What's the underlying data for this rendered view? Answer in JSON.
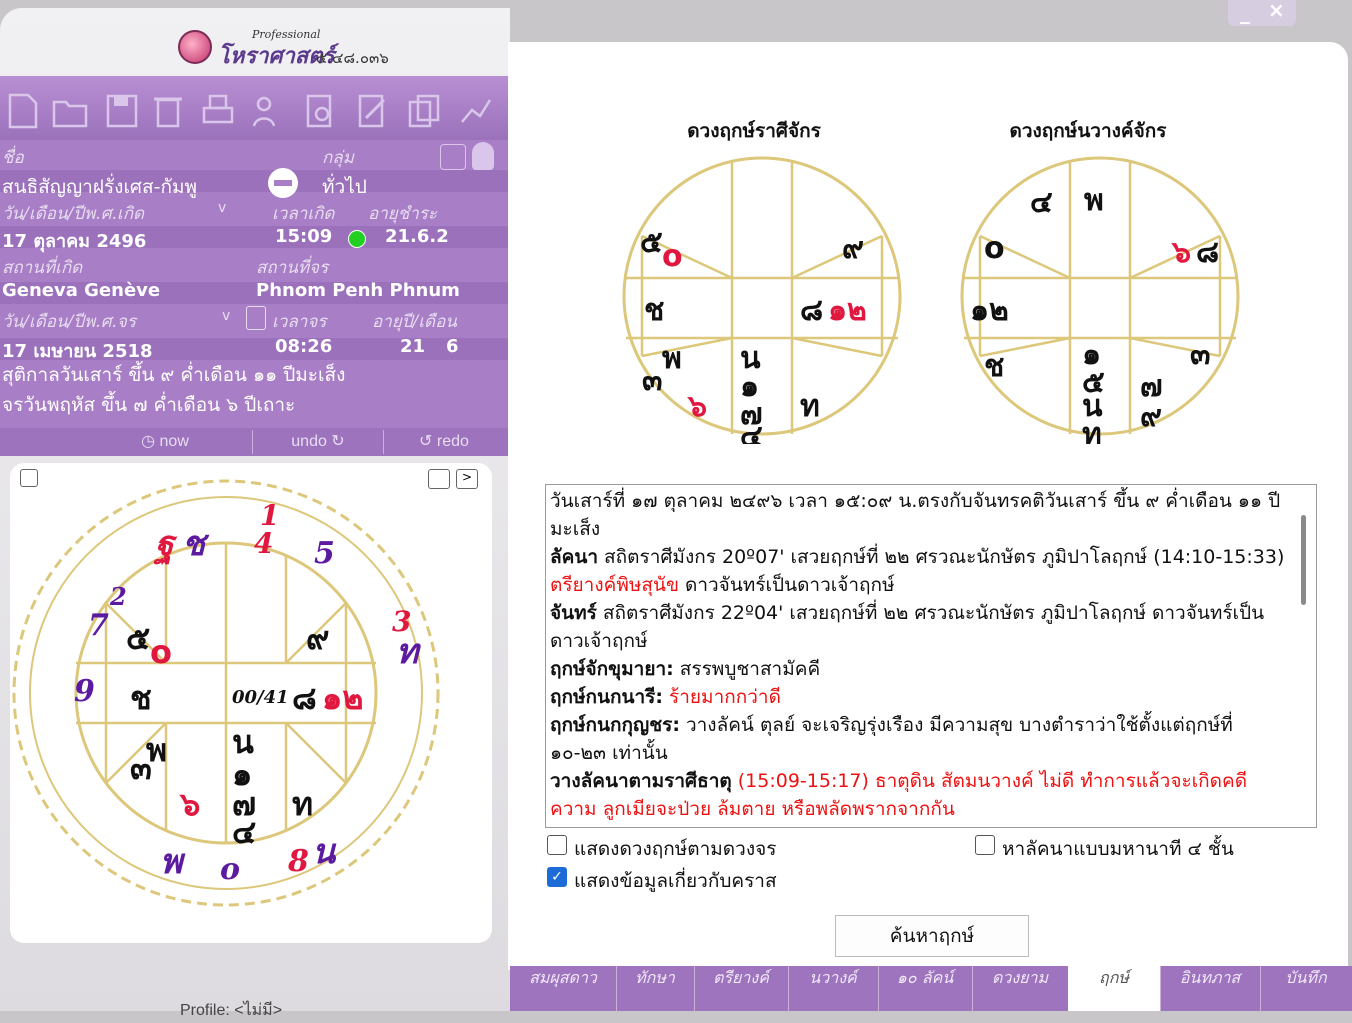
{
  "window": {
    "minimize": "_",
    "close": "×"
  },
  "app": {
    "title_small": "Professional",
    "title_main": "โหราศาสตร์",
    "version": "๕.๔๘.๐๓๖"
  },
  "toolbar": {
    "icons": [
      "new-file-icon",
      "open-folder-icon",
      "save-icon",
      "delete-icon",
      "print-icon",
      "people-icon",
      "search-doc-icon",
      "edit-icon",
      "copy-icon",
      "graph-icon"
    ]
  },
  "info": {
    "name_label": "ชื่อ",
    "name_value": "สนธิสัญญาฝรั่งเศส-กัมพู",
    "group_label": "กลุ่ม",
    "group_value": "ทั่วไป",
    "birth_date_label": "วัน/เดือน/ปีพ.ศ.เกิด",
    "birth_time_label": "เวลาเกิด",
    "age_label": "อายุชำระ",
    "birth_date": "17 ตุลาคม 2496",
    "birth_time": "15:09",
    "age_value": "21.6.2",
    "birth_place_label": "สถานที่เกิด",
    "current_place_label": "สถานที่จร",
    "birth_place": "Geneva  Genève",
    "current_place": "Phnom Penh  Phnum",
    "transit_date_label": "วัน/เดือน/ปีพ.ศ.จร",
    "transit_time_label": "เวลาจร",
    "age_year_month_label": "อายุปี/เดือน",
    "transit_date": "17 เมษายน 2518",
    "transit_time": "08:26",
    "age_years": "21",
    "age_months": "6",
    "line1": "สุติกาลวันเสาร์ ขึ้น ๙ ค่ำเดือน ๑๑ ปีมะเส็ง",
    "line2": "จรวันพฤหัส ขึ้น ๗ ค่ำเดือน ๖ ปีเถาะ"
  },
  "undo_bar": {
    "now": "now",
    "undo": "undo",
    "redo": "redo"
  },
  "profile": "Profile: <ไม่มี>",
  "right": {
    "chart1_title": "ดวงฤกษ์ราศีจักร",
    "chart2_title": "ดวงฤกษ์นวางค์จักร",
    "text": {
      "p1": "วันเสาร์ที่ ๑๗ ตุลาคม ๒๔๙๖ เวลา ๑๕:๐๙ น.ตรงกับจันทรคติวันเสาร์ ขึ้น ๙ ค่ำเดือน ๑๑ ปีมะเส็ง",
      "lagna_h": "ลัคนา",
      "lagna_t": " สถิตราศีมังกร 20º07' เสวยฤกษ์ที่ ๒๒ ศรวณะนักษัตร ภูมิปาโลฤกษ์ (14:10-15:33) ",
      "lagna_red": "ตรียางค์พิษสุนัข",
      "lagna_t2": " ดาวจันทร์เป็นดาวเจ้าฤกษ์",
      "moon_h": "จันทร์",
      "moon_t": " สถิตราศีมังกร 22º04' เสวยฤกษ์ที่ ๒๒ ศรวณะนักษัตร ภูมิปาโลฤกษ์ ดาวจันทร์เป็นดาวเจ้าฤกษ์",
      "r1_h": "ฤกษ์จักขุมายา:",
      "r1_t": " สรรพบูชาสามัคคี",
      "r2_h": "ฤกษ์กนกนารี:",
      "r2_red": " ร้ายมากกว่าดี",
      "r3_h": "ฤกษ์กนกกุญชร:",
      "r3_t": " วางลัคน์ ตุลย์ จะเจริญรุ่งเรือง มีความสุข บางตำราว่าใช้ตั้งแต่ฤกษ์ที่ ๑๐-๒๓ เท่านั้น",
      "r4_h": "วางลัคนาตามราศีธาตุ",
      "r4_red": " (15:09-15:17) ธาตุดิน สัตมนวางค์ ไม่ดี ทำการแล้วจะเกิดคดีความ ลูกเมียจะป่วย ล้มตาย หรือพลัดพรากจากกัน"
    },
    "cb1": "แสดงดวงฤกษ์ตามดวงจร",
    "cb2": "หาลัคนาแบบมหานาที ๔ ชั้น",
    "cb3": "แสดงข้อมูลเกี่ยวกับคราส",
    "cb3_checked": true,
    "search_button": "ค้นหาฤกษ์"
  },
  "tabs": [
    "สมผุสดาว",
    "ทักษา",
    "ตรียางค์",
    "นวางค์",
    "๑๐ ลัคน์",
    "ดวงยาม",
    "ฤกษ์",
    "อินทภาส",
    "บันทึก"
  ],
  "active_tab": "ฤกษ์",
  "charts": {
    "main_center": "00/41",
    "main_houses": [
      "๕o",
      "๙",
      "ช",
      "๘๑๒",
      "๓พ",
      "๖",
      "น๑๗๔",
      "ท"
    ],
    "outer_marks": [
      "ฐช",
      "1",
      "4",
      "5",
      "2",
      "7",
      "3",
      "ท",
      "9",
      "8",
      "พ",
      "o",
      "น"
    ],
    "rasi_houses": [
      "๕o",
      "๙",
      "ช",
      "๘๑๒",
      "๓พ",
      "๖",
      "น๑๗๔",
      "ท"
    ],
    "nava_houses": [
      "๔",
      "พ",
      "o",
      "๖๘",
      "๑๒",
      "ช",
      "๑๕นท",
      "๗๙",
      "๓"
    ]
  },
  "colors": {
    "purple": "#a87fc6",
    "gold": "#dcc77a",
    "red": "#e11",
    "accent_blue": "#1d6bd6"
  }
}
